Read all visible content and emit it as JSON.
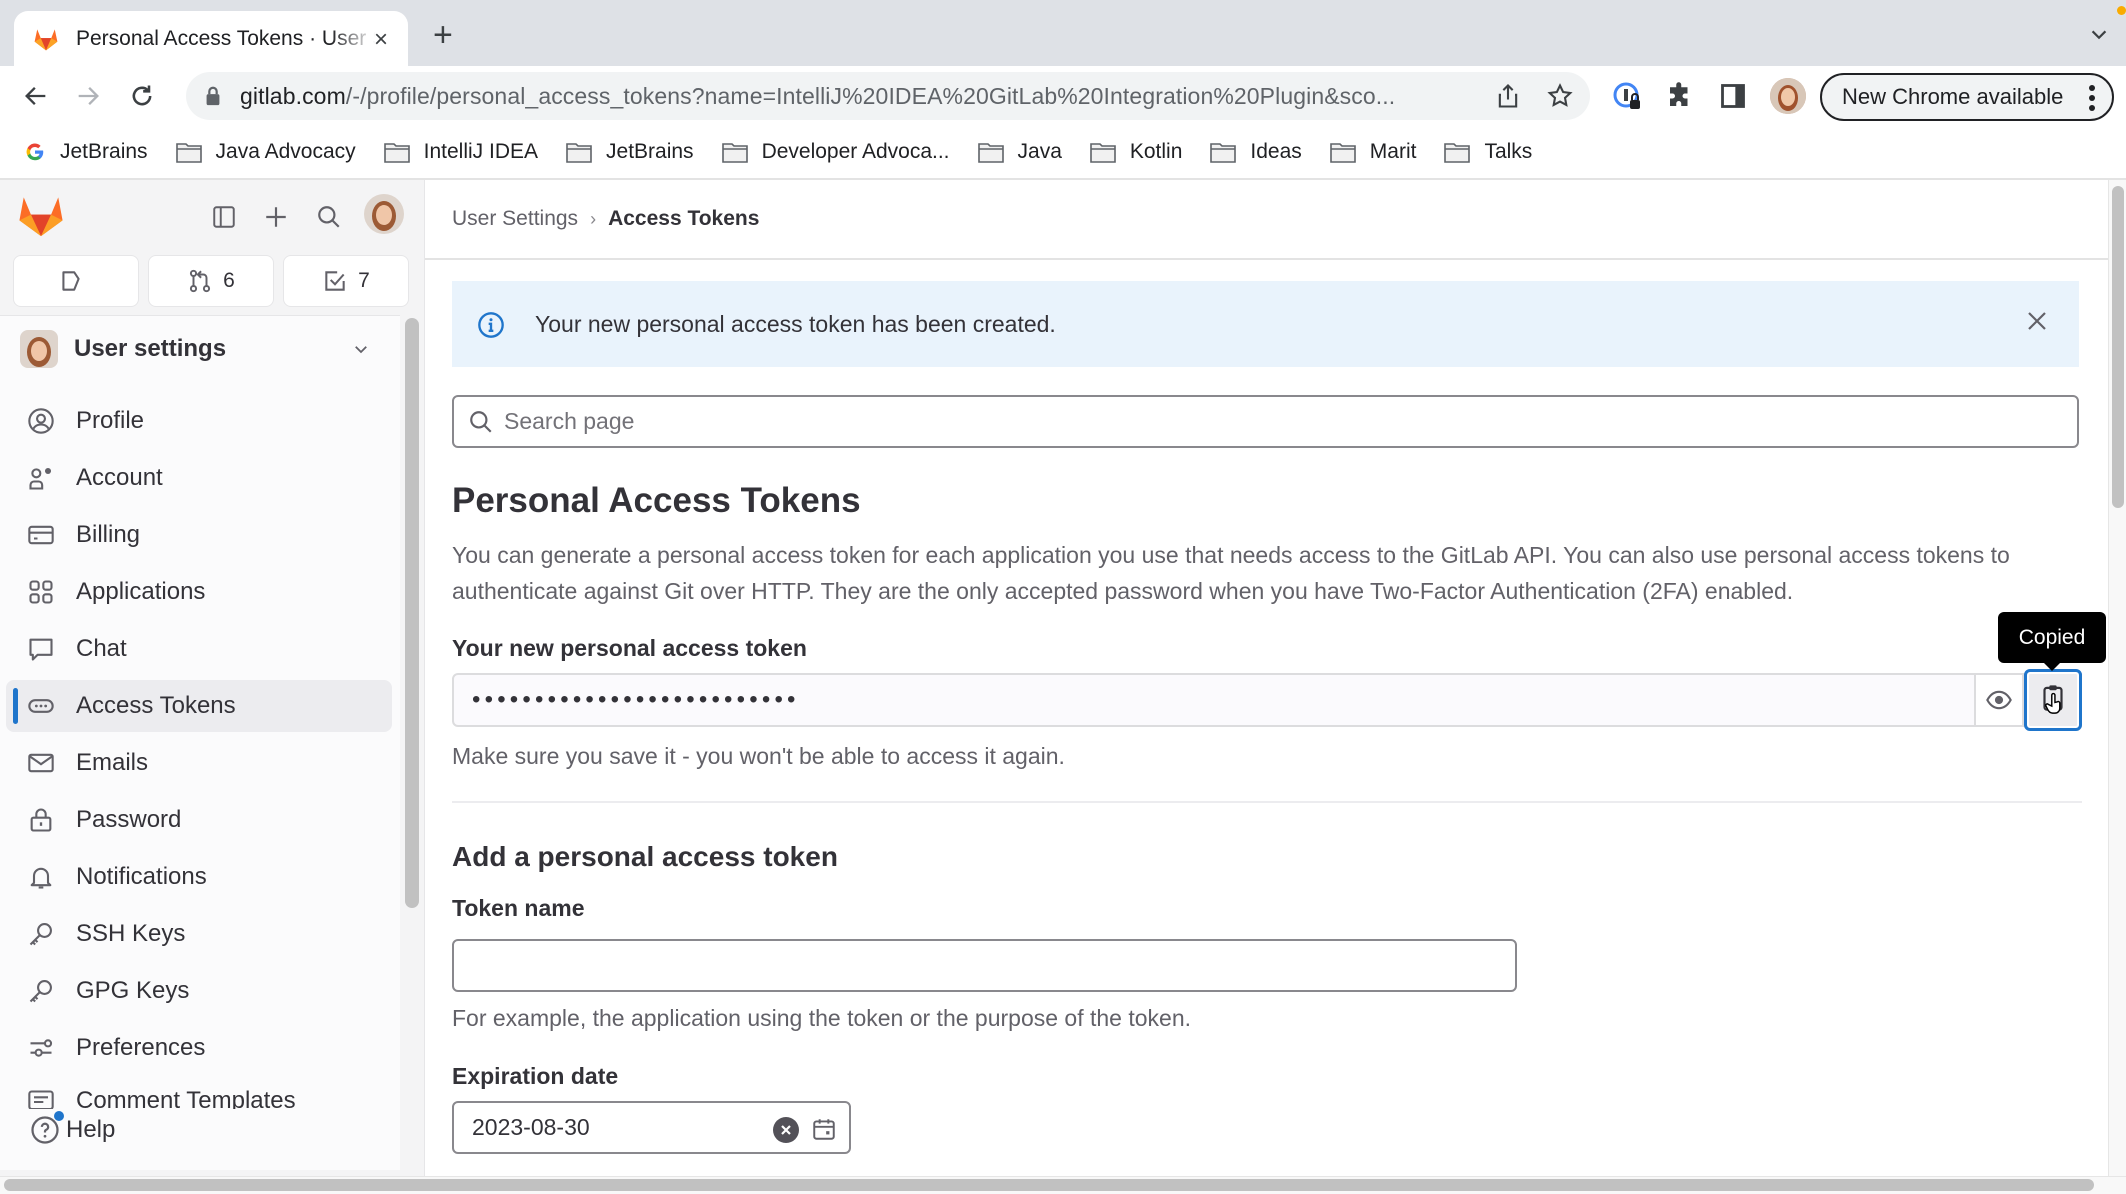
{
  "browser": {
    "tab_title": "Personal Access Tokens · User Settings · GitLab",
    "tab_close": "×",
    "new_tab": "+",
    "url": "gitlab.com/-/profile/personal_access_tokens?name=IntelliJ%20IDEA%20GitLab%20Integration%20Plugin&sco...",
    "url_host": "gitlab.com",
    "url_path": "/-/profile/personal_access_tokens?name=IntelliJ%20IDEA%20GitLab%20Integration%20Plugin&sco...",
    "update_button": "New Chrome available",
    "bookmarks": [
      {
        "label": "JetBrains",
        "icon": "google-icon"
      },
      {
        "label": "Java Advocacy",
        "icon": "folder-icon"
      },
      {
        "label": "IntelliJ IDEA",
        "icon": "folder-icon"
      },
      {
        "label": "JetBrains",
        "icon": "folder-icon"
      },
      {
        "label": "Developer Advoca...",
        "icon": "folder-icon"
      },
      {
        "label": "Java",
        "icon": "folder-icon"
      },
      {
        "label": "Kotlin",
        "icon": "folder-icon"
      },
      {
        "label": "Ideas",
        "icon": "folder-icon"
      },
      {
        "label": "Marit",
        "icon": "folder-icon"
      },
      {
        "label": "Talks",
        "icon": "folder-icon"
      }
    ]
  },
  "sidebar": {
    "counters": {
      "merge_requests": "6",
      "todos": "7"
    },
    "context_title": "User settings",
    "items": [
      {
        "label": "Profile",
        "icon": "profile-icon"
      },
      {
        "label": "Account",
        "icon": "account-icon"
      },
      {
        "label": "Billing",
        "icon": "billing-icon"
      },
      {
        "label": "Applications",
        "icon": "applications-icon"
      },
      {
        "label": "Chat",
        "icon": "chat-icon"
      },
      {
        "label": "Access Tokens",
        "icon": "token-icon",
        "active": true
      },
      {
        "label": "Emails",
        "icon": "mail-icon"
      },
      {
        "label": "Password",
        "icon": "lock-icon"
      },
      {
        "label": "Notifications",
        "icon": "bell-icon"
      },
      {
        "label": "SSH Keys",
        "icon": "key-icon"
      },
      {
        "label": "GPG Keys",
        "icon": "key-icon"
      },
      {
        "label": "Preferences",
        "icon": "preferences-icon"
      },
      {
        "label": "Comment Templates",
        "icon": "comment-icon"
      }
    ],
    "help": "Help"
  },
  "main": {
    "breadcrumb": [
      "User Settings",
      "Access Tokens"
    ],
    "breadcrumb_sep": "›",
    "alert": "Your new personal access token has been created.",
    "search_placeholder": "Search page",
    "title": "Personal Access Tokens",
    "intro": "You can generate a personal access token for each application you use that needs access to the GitLab API. You can also use personal access tokens to authenticate against Git over HTTP. They are the only accepted password when you have Two-Factor Authentication (2FA) enabled.",
    "new_token_label": "Your new personal access token",
    "new_token_masked": "••••••••••••••••••••••••••",
    "copy_tooltip": "Copied",
    "new_token_help": "Make sure you save it - you won't be able to access it again.",
    "add_title": "Add a personal access token",
    "token_name_label": "Token name",
    "token_name_value": "",
    "token_name_help": "For example, the application using the token or the purpose of the token.",
    "expiration_label": "Expiration date",
    "expiration_value": "2023-08-30"
  },
  "colors": {
    "accent": "#1f75cb",
    "alert_bg": "#e9f3fc",
    "tooltip_bg": "#000000",
    "gitlab_orange": "#e24329"
  }
}
